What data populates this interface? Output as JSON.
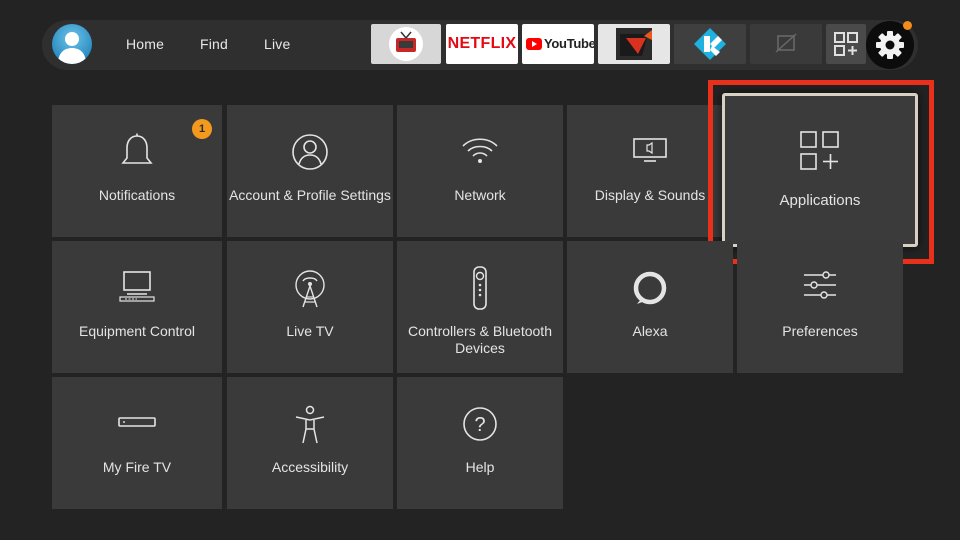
{
  "nav": {
    "links": [
      "Home",
      "Find",
      "Live"
    ]
  },
  "apps": {
    "netflix_label": "NETFLIX",
    "youtube_label": "YouTube"
  },
  "settings": {
    "tiles": [
      {
        "label": "Notifications",
        "icon": "bell-icon",
        "badge": "1"
      },
      {
        "label": "Account & Profile Settings",
        "icon": "person-icon"
      },
      {
        "label": "Network",
        "icon": "wifi-icon"
      },
      {
        "label": "Display & Sounds",
        "icon": "tv-speaker-icon"
      },
      {
        "label": "Applications",
        "icon": "apps-grid-plus-icon",
        "focused": true
      },
      {
        "label": "Equipment Control",
        "icon": "monitor-icon"
      },
      {
        "label": "Live TV",
        "icon": "antenna-icon"
      },
      {
        "label": "Controllers & Bluetooth Devices",
        "icon": "remote-icon"
      },
      {
        "label": "Alexa",
        "icon": "alexa-ring-icon"
      },
      {
        "label": "Preferences",
        "icon": "sliders-icon"
      },
      {
        "label": "My Fire TV",
        "icon": "fire-stick-icon"
      },
      {
        "label": "Accessibility",
        "icon": "accessibility-icon"
      },
      {
        "label": "Help",
        "icon": "help-icon"
      }
    ]
  },
  "colors": {
    "background": "#232323",
    "tile": "#3a3a3a",
    "badge": "#f39a1e",
    "highlight": "#e8301c",
    "netflix_red": "#e50914",
    "youtube_red": "#ff0000"
  }
}
